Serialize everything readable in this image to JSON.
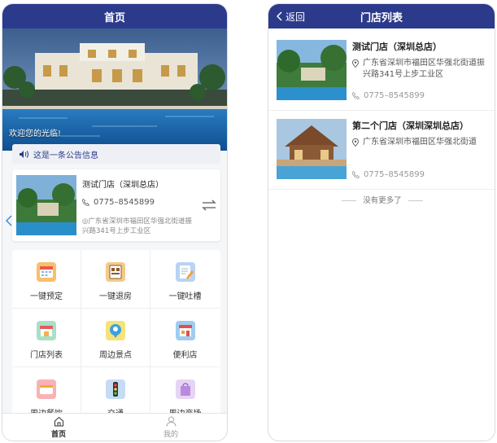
{
  "left_screen": {
    "title": "首页",
    "welcome_text": "欢迎您的光临!",
    "notice_text": "这是一条公告信息",
    "store_card": {
      "name": "测试门店（深圳总店）",
      "phone": "0775–8545899",
      "address": "广东省深圳市福田区华强北街道振兴路341号上步工业区"
    },
    "grid_items": [
      {
        "label": "一键预定",
        "icon": "calendar-icon"
      },
      {
        "label": "一键退房",
        "icon": "checkout-icon"
      },
      {
        "label": "一键吐槽",
        "icon": "feedback-icon"
      },
      {
        "label": "门店列表",
        "icon": "store-icon"
      },
      {
        "label": "周边景点",
        "icon": "location-pin-icon"
      },
      {
        "label": "便利店",
        "icon": "shop-icon"
      },
      {
        "label": "周边餐饮",
        "icon": "food-icon"
      },
      {
        "label": "交通",
        "icon": "traffic-icon"
      },
      {
        "label": "周边商场",
        "icon": "shopping-bag-icon"
      }
    ],
    "tabs": [
      {
        "label": "首页",
        "icon": "home-icon",
        "active": true
      },
      {
        "label": "我的",
        "icon": "user-icon",
        "active": false
      }
    ]
  },
  "right_screen": {
    "title": "门店列表",
    "back_label": "返回",
    "stores": [
      {
        "name": "测试门店（深圳总店）",
        "address": "广东省深圳市福田区华强北街道振兴路341号上步工业区",
        "phone": "0775–8545899"
      },
      {
        "name": "第二个门店（深圳深圳总店）",
        "address": "广东省深圳市福田区华强北街道",
        "phone": "0775–8545899"
      }
    ],
    "no_more_text": "没有更多了"
  },
  "colors": {
    "navbar": "#2c3a8c",
    "accent": "#2c3a8c",
    "background": "#f5f6f8"
  }
}
